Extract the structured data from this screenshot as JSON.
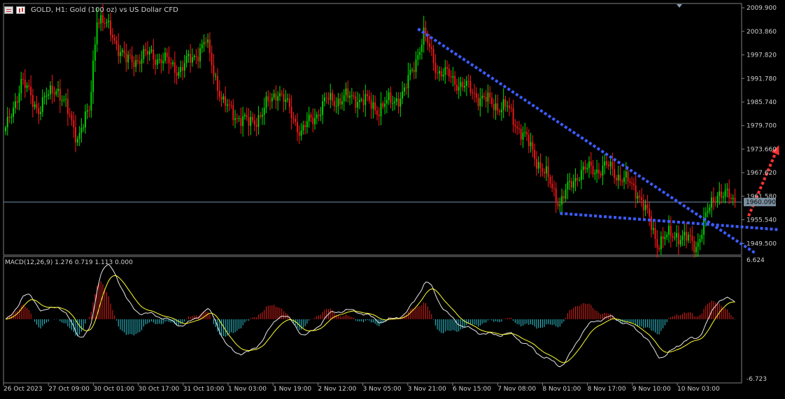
{
  "header": {
    "title": "GOLD, H1:  Gold (100 oz) vs US Dollar CFD",
    "icon_1": "grid-icon",
    "icon_2": "candlestick-icon"
  },
  "macd": {
    "label": "MACD(12,26,9) 1.276 0.719 1.113 0.000",
    "axis_top": "6.624",
    "axis_bottom": "-6.723"
  },
  "price_axis": {
    "labels": [
      "2009.900",
      "2003.860",
      "1997.820",
      "1991.780",
      "1985.740",
      "1979.700",
      "1973.660",
      "1967.620",
      "1961.580",
      "1955.540",
      "1949.500"
    ],
    "current_price": "1960.090"
  },
  "time_axis": {
    "labels": [
      "26 Oct 2023",
      "27 Oct 09:00",
      "30 Oct 01:00",
      "30 Oct 17:00",
      "31 Oct 10:00",
      "1 Nov 03:00",
      "1 Nov 19:00",
      "2 Nov 12:00",
      "3 Nov 05:00",
      "3 Nov 21:00",
      "6 Nov 15:00",
      "7 Nov 08:00",
      "8 Nov 01:00",
      "8 Nov 17:00",
      "9 Nov 10:00",
      "10 Nov 03:00"
    ]
  },
  "colors": {
    "background": "#000000",
    "bull": "#00e000",
    "bear": "#ff1a1a",
    "hist_pos": "#e0241c",
    "hist_neg": "#2fc9d6",
    "macd_line": "#e8e8e8",
    "signal_line": "#ffff33",
    "trendline": "#3c5cff",
    "arrow": "#ff3333",
    "grid": "#808080",
    "price_line": "#6f8fa8"
  },
  "chart_data": {
    "type": "candlestick",
    "symbol": "GOLD",
    "timeframe": "H1",
    "ylim": [
      1946.5,
      2011.0
    ],
    "key_points": [
      {
        "x": 0,
        "y": 1978
      },
      {
        "x": 8,
        "y": 1991
      },
      {
        "x": 17,
        "y": 1984
      },
      {
        "x": 26,
        "y": 1990
      },
      {
        "x": 37,
        "y": 1977
      },
      {
        "x": 43,
        "y": 1983
      },
      {
        "x": 47,
        "y": 2008
      },
      {
        "x": 55,
        "y": 2003
      },
      {
        "x": 62,
        "y": 1996
      },
      {
        "x": 75,
        "y": 1998
      },
      {
        "x": 90,
        "y": 1994
      },
      {
        "x": 103,
        "y": 2001
      },
      {
        "x": 112,
        "y": 1985
      },
      {
        "x": 125,
        "y": 1980
      },
      {
        "x": 132,
        "y": 1983
      },
      {
        "x": 140,
        "y": 1989
      },
      {
        "x": 152,
        "y": 1978
      },
      {
        "x": 165,
        "y": 1986
      },
      {
        "x": 180,
        "y": 1987
      },
      {
        "x": 192,
        "y": 1984
      },
      {
        "x": 205,
        "y": 1988
      },
      {
        "x": 215,
        "y": 2003
      },
      {
        "x": 222,
        "y": 1994
      },
      {
        "x": 235,
        "y": 1990
      },
      {
        "x": 247,
        "y": 1986
      },
      {
        "x": 258,
        "y": 1984
      },
      {
        "x": 270,
        "y": 1974
      },
      {
        "x": 285,
        "y": 1960
      },
      {
        "x": 295,
        "y": 1968
      },
      {
        "x": 310,
        "y": 1969
      },
      {
        "x": 325,
        "y": 1963
      },
      {
        "x": 335,
        "y": 1950
      },
      {
        "x": 345,
        "y": 1952
      },
      {
        "x": 355,
        "y": 1949
      },
      {
        "x": 360,
        "y": 1956
      },
      {
        "x": 366,
        "y": 1963
      },
      {
        "x": 375,
        "y": 1960
      }
    ],
    "current_price": 1960.09,
    "macd": {
      "params": "12,26,9",
      "macd": 1.276,
      "signal": 0.719,
      "histogram": 1.113,
      "level": 0.0,
      "ylim": [
        -6.723,
        6.624
      ]
    },
    "annotations": [
      {
        "type": "trendline",
        "from": {
          "x": 212,
          "y": 2004.5
        },
        "to": {
          "x": 386,
          "y": 1946.8
        }
      },
      {
        "type": "trendline",
        "from": {
          "x": 285,
          "y": 1957.2
        },
        "to": {
          "x": 398,
          "y": 1953.0
        }
      },
      {
        "type": "arrow",
        "from": {
          "x": 382,
          "y": 1956.5
        },
        "to": {
          "x": 397,
          "y": 1974.0
        }
      }
    ]
  }
}
